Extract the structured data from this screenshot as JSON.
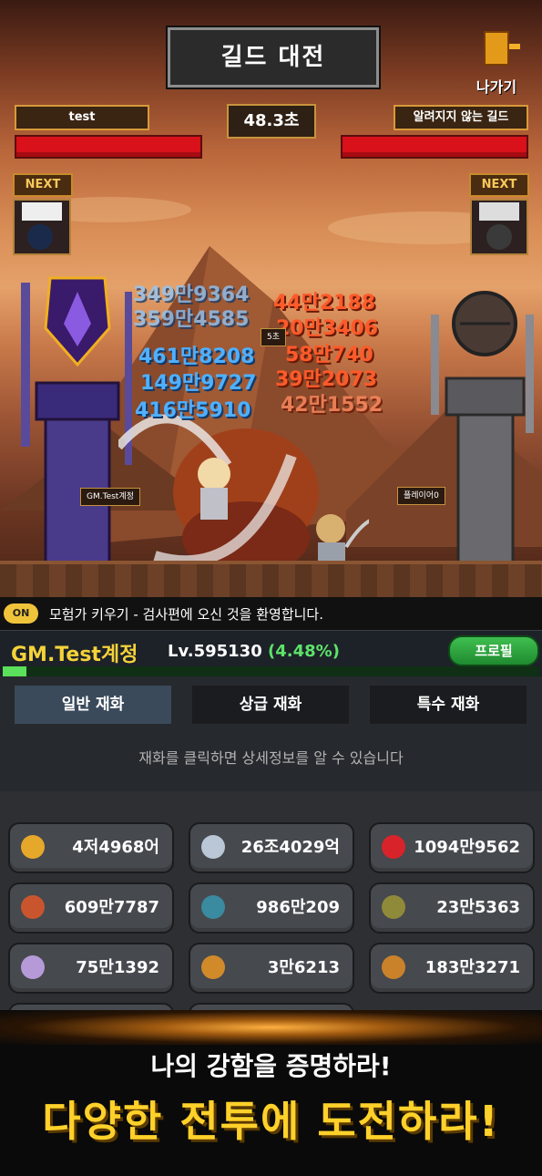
{
  "battle": {
    "title": "길드 대전",
    "exit_label": "나가기",
    "left_guild": "test",
    "right_guild": "알려지지 않는 길드",
    "timer": "48.3초",
    "next_label": "NEXT",
    "left_player_tag": "GM.Test계정",
    "right_player_tag": "플레이어0",
    "combo": "5초",
    "blue_damage": [
      "349만9364",
      "359만4585",
      "461만8208",
      "149만9727",
      "416만5910"
    ],
    "red_damage": [
      "44만2188",
      "20만3406",
      "58만740",
      "39만2073",
      "42만1552"
    ]
  },
  "chat": {
    "on_label": "ON",
    "message": "모험가 키우기 - 검사편에 오신 것을 환영합니다."
  },
  "player": {
    "name": "GM.Test계정",
    "level": "Lv.595130",
    "percent": "(4.48%)",
    "xp_fraction": 0.0448,
    "profile_button": "프로필"
  },
  "tabs": {
    "items": [
      "일반 재화",
      "상급 재화",
      "특수 재화"
    ],
    "hint": "재화를 클릭하면 상세정보를 알 수 있습니다"
  },
  "currencies": [
    {
      "icon": "gold-coin-icon",
      "color": "#e6a82a",
      "value": "4저4968어"
    },
    {
      "icon": "skull-coin-icon",
      "color": "#b9c7d6",
      "value": "26조4029억"
    },
    {
      "icon": "ruby-icon",
      "color": "#d8232a",
      "value": "1094만9562"
    },
    {
      "icon": "red-crystal-icon",
      "color": "#c9552e",
      "value": "609만7787"
    },
    {
      "icon": "blue-ore-icon",
      "color": "#3a8aa0",
      "value": "986만209"
    },
    {
      "icon": "ore-pile-icon",
      "color": "#8f8a3a",
      "value": "23만5363"
    },
    {
      "icon": "purple-crystal-icon",
      "color": "#b69ad8",
      "value": "75만1392"
    },
    {
      "icon": "trophy-icon",
      "color": "#d08a2a",
      "value": "3만6213"
    },
    {
      "icon": "armor-icon",
      "color": "#c9822a",
      "value": "183만3271"
    }
  ],
  "banner": {
    "line1": "나의 강함을 증명하라!",
    "line2": "다양한 전투에 도전하라!"
  }
}
